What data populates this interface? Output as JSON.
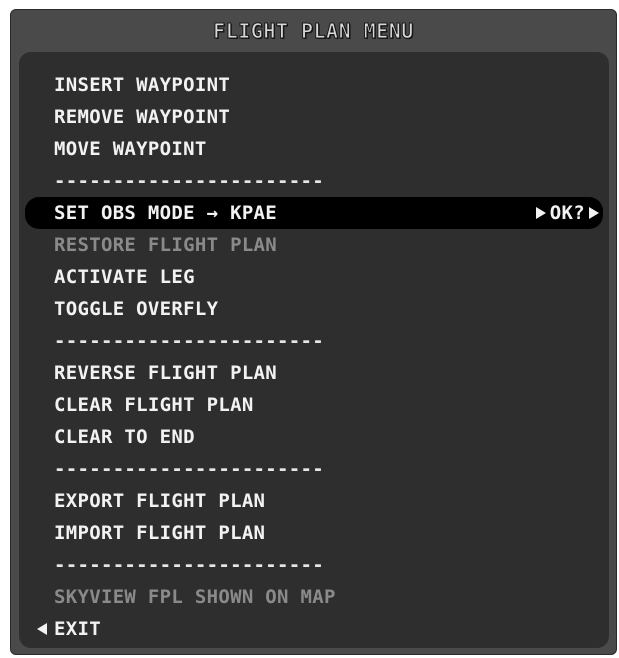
{
  "window": {
    "title": "FLIGHT PLAN MENU"
  },
  "menu": {
    "items": [
      {
        "label": "INSERT WAYPOINT",
        "state": "enabled"
      },
      {
        "label": "REMOVE WAYPOINT",
        "state": "enabled"
      },
      {
        "label": "MOVE WAYPOINT",
        "state": "enabled"
      },
      {
        "label": "-----------------------",
        "state": "separator"
      },
      {
        "label": "SET OBS MODE → KPAE",
        "state": "selected",
        "confirm_label": "OK?"
      },
      {
        "label": "RESTORE FLIGHT PLAN",
        "state": "disabled"
      },
      {
        "label": "ACTIVATE LEG",
        "state": "enabled"
      },
      {
        "label": "TOGGLE OVERFLY",
        "state": "enabled"
      },
      {
        "label": "-----------------------",
        "state": "separator"
      },
      {
        "label": "REVERSE FLIGHT PLAN",
        "state": "enabled"
      },
      {
        "label": "CLEAR FLIGHT PLAN",
        "state": "enabled"
      },
      {
        "label": "CLEAR TO END",
        "state": "enabled"
      },
      {
        "label": "-----------------------",
        "state": "separator"
      },
      {
        "label": "EXPORT FLIGHT PLAN",
        "state": "enabled"
      },
      {
        "label": "IMPORT FLIGHT PLAN",
        "state": "enabled"
      },
      {
        "label": "-----------------------",
        "state": "separator"
      },
      {
        "label": "SKYVIEW FPL SHOWN ON MAP",
        "state": "disabled"
      },
      {
        "label": "EXIT",
        "state": "exit"
      }
    ]
  },
  "icons": {
    "confirm_left_arrow": "triangle-right-icon",
    "confirm_right_arrow": "triangle-right-icon",
    "exit_arrow": "triangle-left-icon"
  },
  "colors": {
    "frame": "#4a4a4a",
    "panel": "#2e2e2e",
    "text": "#f2f2f2",
    "text_disabled": "#8a8a8a",
    "selected_background": "#000000"
  }
}
